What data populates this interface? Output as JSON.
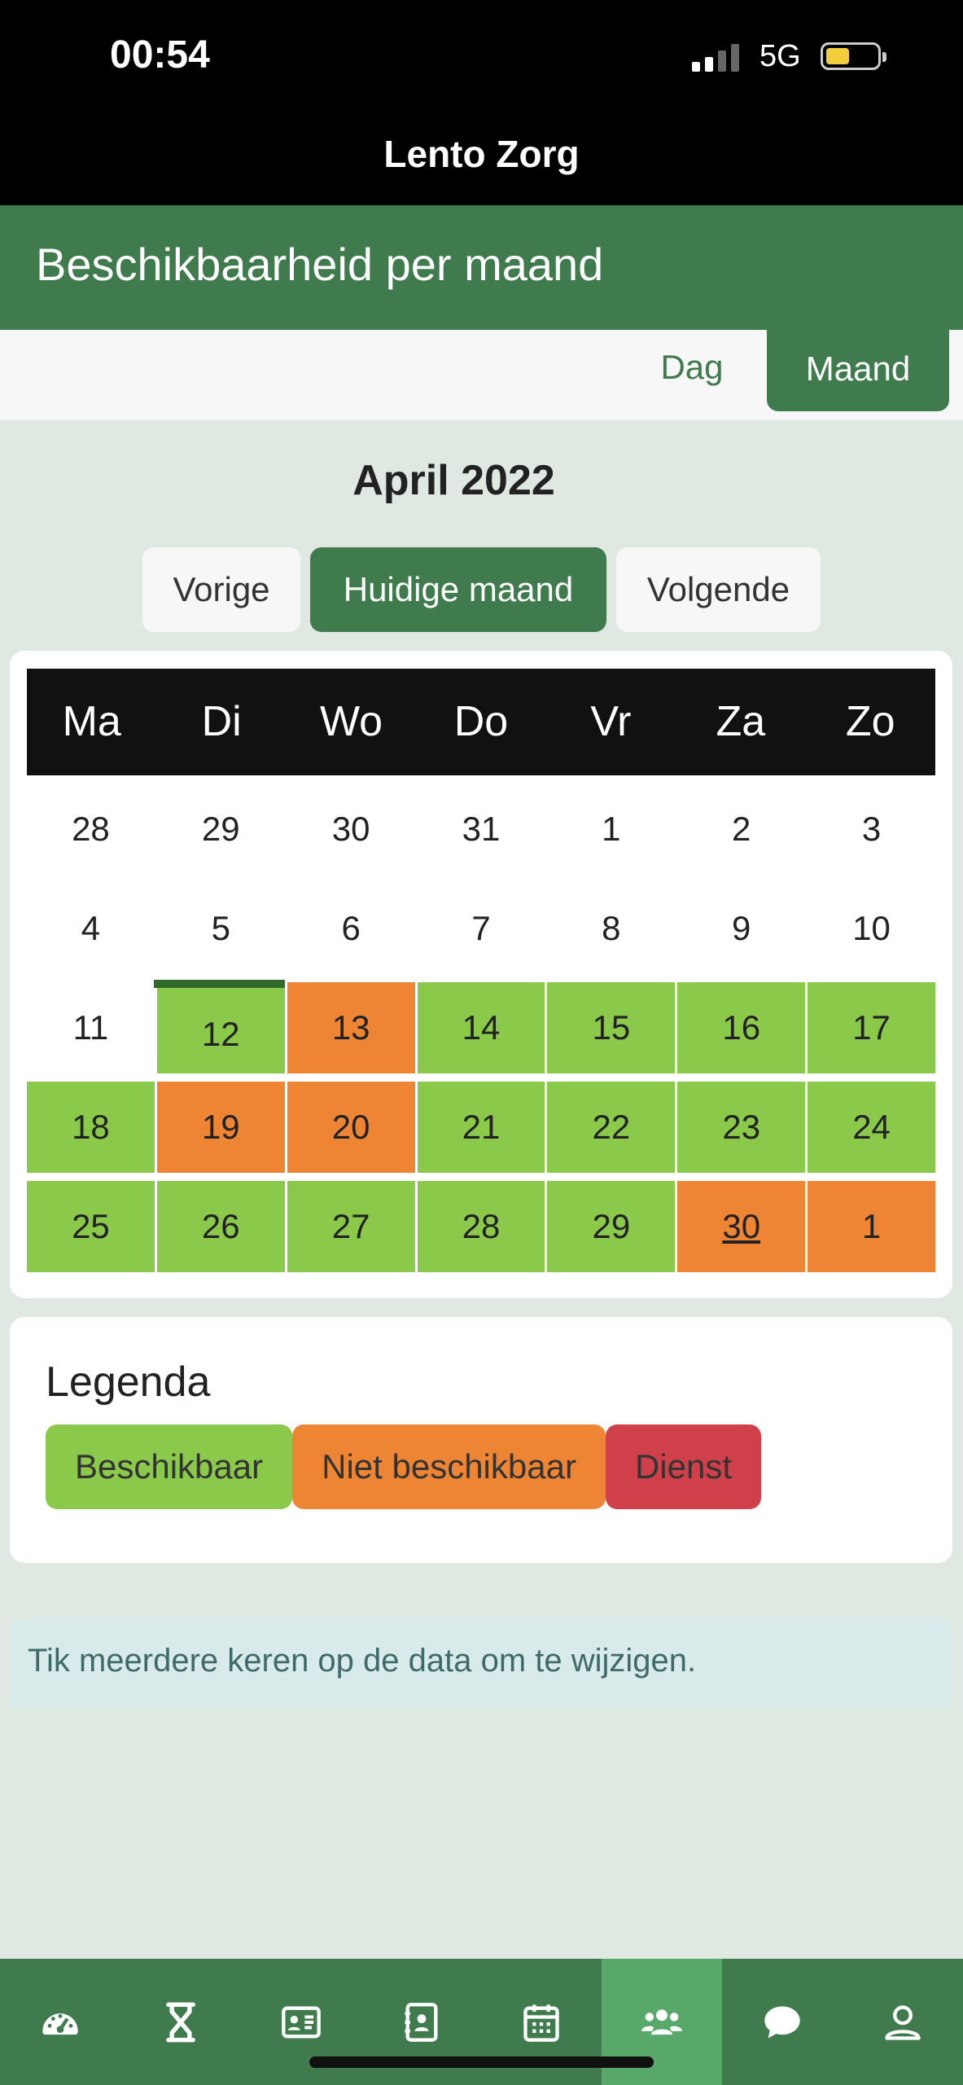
{
  "status": {
    "time": "00:54",
    "network": "5G"
  },
  "app": {
    "title": "Lento Zorg"
  },
  "page": {
    "title": "Beschikbaarheid per maand"
  },
  "view_toggle": {
    "day": "Dag",
    "month": "Maand",
    "active": "month"
  },
  "calendar": {
    "month_title": "April 2022",
    "prev": "Vorige",
    "current": "Huidige maand",
    "next": "Volgende",
    "weekdays": [
      "Ma",
      "Di",
      "Wo",
      "Do",
      "Vr",
      "Za",
      "Zo"
    ],
    "weeks": [
      [
        {
          "d": "28",
          "s": "none"
        },
        {
          "d": "29",
          "s": "none"
        },
        {
          "d": "30",
          "s": "none"
        },
        {
          "d": "31",
          "s": "none"
        },
        {
          "d": "1",
          "s": "none"
        },
        {
          "d": "2",
          "s": "none"
        },
        {
          "d": "3",
          "s": "none"
        }
      ],
      [
        {
          "d": "4",
          "s": "none"
        },
        {
          "d": "5",
          "s": "none"
        },
        {
          "d": "6",
          "s": "none"
        },
        {
          "d": "7",
          "s": "none"
        },
        {
          "d": "8",
          "s": "none"
        },
        {
          "d": "9",
          "s": "none"
        },
        {
          "d": "10",
          "s": "none"
        }
      ],
      [
        {
          "d": "11",
          "s": "none"
        },
        {
          "d": "12",
          "s": "avail",
          "today": true
        },
        {
          "d": "13",
          "s": "unavail"
        },
        {
          "d": "14",
          "s": "avail"
        },
        {
          "d": "15",
          "s": "avail"
        },
        {
          "d": "16",
          "s": "avail"
        },
        {
          "d": "17",
          "s": "avail"
        }
      ],
      [
        {
          "d": "18",
          "s": "avail"
        },
        {
          "d": "19",
          "s": "unavail"
        },
        {
          "d": "20",
          "s": "unavail"
        },
        {
          "d": "21",
          "s": "avail"
        },
        {
          "d": "22",
          "s": "avail"
        },
        {
          "d": "23",
          "s": "avail"
        },
        {
          "d": "24",
          "s": "avail"
        }
      ],
      [
        {
          "d": "25",
          "s": "avail"
        },
        {
          "d": "26",
          "s": "avail"
        },
        {
          "d": "27",
          "s": "avail"
        },
        {
          "d": "28",
          "s": "avail"
        },
        {
          "d": "29",
          "s": "avail"
        },
        {
          "d": "30",
          "s": "unavail",
          "selected": true
        },
        {
          "d": "1",
          "s": "unavail"
        }
      ]
    ]
  },
  "legend": {
    "title": "Legenda",
    "available": "Beschikbaar",
    "unavailable": "Niet beschikbaar",
    "duty": "Dienst"
  },
  "info": {
    "text": "Tik meerdere keren op de data om te wijzigen."
  },
  "colors": {
    "primary": "#3f7b4d",
    "available": "#8bc94a",
    "unavailable": "#ee8535",
    "duty": "#d0404a",
    "tab_active": "#58a86a"
  },
  "tabs": [
    {
      "icon": "dashboard-icon",
      "active": false
    },
    {
      "icon": "hourglass-icon",
      "active": false
    },
    {
      "icon": "id-card-icon",
      "active": false
    },
    {
      "icon": "address-book-icon",
      "active": false
    },
    {
      "icon": "calendar-icon",
      "active": false
    },
    {
      "icon": "users-icon",
      "active": true
    },
    {
      "icon": "chat-icon",
      "active": false
    },
    {
      "icon": "user-icon",
      "active": false
    }
  ]
}
